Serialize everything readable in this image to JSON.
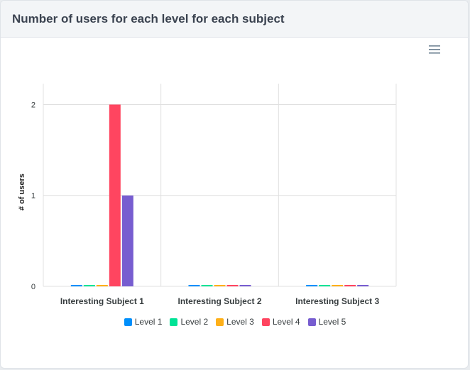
{
  "header": {
    "title": "Number of users for each level for each subject"
  },
  "toolbar": {
    "menu_icon": "hamburger-icon"
  },
  "colors": {
    "grid": "#e0e0e0",
    "axis_text": "#373d3f",
    "series": [
      "#008ffb",
      "#00e396",
      "#feb019",
      "#ff4560",
      "#775dd0"
    ]
  },
  "chart_data": {
    "type": "bar",
    "title": "",
    "xlabel": "",
    "ylabel": "# of users",
    "ylim": [
      0,
      2
    ],
    "yticks": [
      "0",
      "1",
      "2"
    ],
    "grid": true,
    "legend_position": "bottom",
    "categories": [
      "Interesting Subject 1",
      "Interesting Subject 2",
      "Interesting Subject 3"
    ],
    "series": [
      {
        "name": "Level 1",
        "values": [
          0,
          0,
          0
        ]
      },
      {
        "name": "Level 2",
        "values": [
          0,
          0,
          0
        ]
      },
      {
        "name": "Level 3",
        "values": [
          0,
          0,
          0
        ]
      },
      {
        "name": "Level 4",
        "values": [
          2,
          0,
          0
        ]
      },
      {
        "name": "Level 5",
        "values": [
          1,
          0,
          0
        ]
      }
    ]
  }
}
